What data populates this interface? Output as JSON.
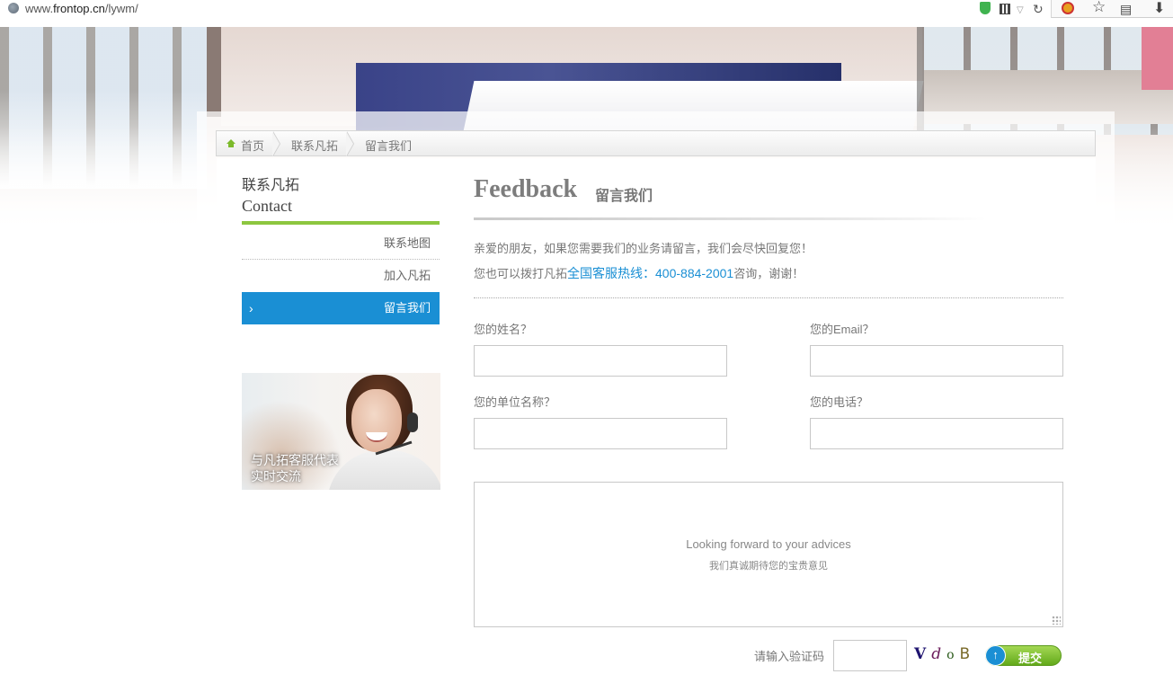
{
  "browser": {
    "url_prefix": "www.",
    "url_domain": "frontop.cn",
    "url_path": "/lywm/"
  },
  "breadcrumb": {
    "items": [
      "首页",
      "联系凡拓",
      "留言我们"
    ]
  },
  "sidebar": {
    "title_cn": "联系凡拓",
    "title_en": "Contact",
    "items": [
      {
        "label": "联系地图",
        "active": false
      },
      {
        "label": "加入凡拓",
        "active": false
      },
      {
        "label": "留言我们",
        "active": true
      }
    ],
    "promo_line1": "与凡拓客服代表",
    "promo_line2": "实时交流"
  },
  "main": {
    "title_en": "Feedback",
    "title_cn": "留言我们",
    "intro_line1": "亲爱的朋友，如果您需要我们的业务请留言，我们会尽快回复您！",
    "intro_line2_prefix": "您也可以拨打凡拓",
    "intro_line2_hotline": "全国客服热线：400-884-2001",
    "intro_line2_suffix": "咨询，谢谢！"
  },
  "form": {
    "name_label": "您的姓名？",
    "name_value": "",
    "email_label": "您的Email？",
    "email_value": "",
    "company_label": "您的单位名称？",
    "company_value": "",
    "phone_label": "您的电话？",
    "phone_value": "",
    "message_placeholder_en": "Looking forward to your advices",
    "message_placeholder_cn": "我们真诚期待您的宝贵意见",
    "captcha_label": "请输入验证码",
    "captcha_value": "",
    "captcha_chars": [
      "V",
      "d",
      "o",
      "B"
    ],
    "submit_label": "提交"
  },
  "colors": {
    "accent_blue": "#1a8fd4",
    "accent_green": "#8dc63f"
  }
}
